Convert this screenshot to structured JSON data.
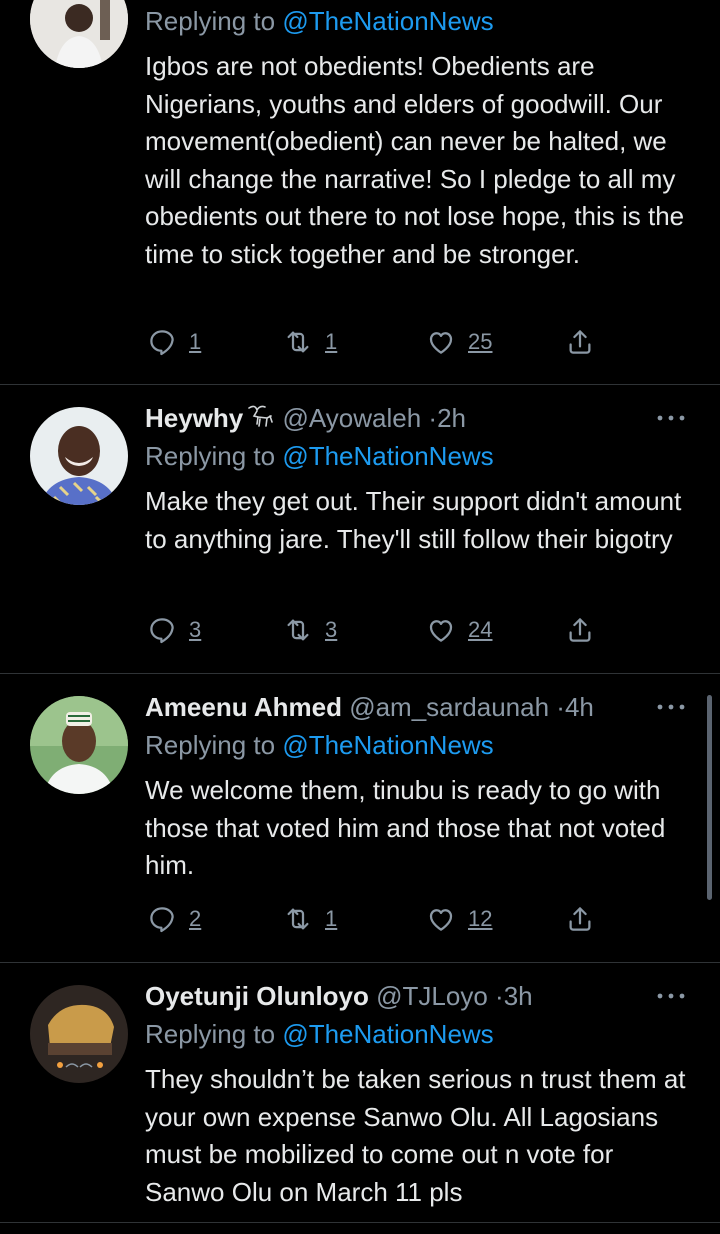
{
  "tweets": [
    {
      "name": "",
      "handle": "",
      "time": "",
      "reply_prefix": "Replying to ",
      "reply_to": "@TheNationNews",
      "text": "Igbos are not obedients! Obedients are Nigerians, youths and elders of goodwill. Our movement(obedient) can never be halted, we will change the narrative! So I pledge to all my obedients out there to not lose hope, this is the time to stick together and be stronger.",
      "replies": "1",
      "retweets": "1",
      "likes": "25"
    },
    {
      "name": "Heywhy",
      "handle": "@Ayowaleh",
      "time": "2h",
      "separator": "·",
      "reply_prefix": "Replying to ",
      "reply_to": "@TheNationNews",
      "text": "Make they get out. Their support didn't amount to anything jare. They'll still follow their bigotry",
      "replies": "3",
      "retweets": "3",
      "likes": "24"
    },
    {
      "name": "Ameenu Ahmed",
      "handle": "@am_sardaunah",
      "time": "4h",
      "separator": "·",
      "reply_prefix": "Replying to ",
      "reply_to": "@TheNationNews",
      "text": "We welcome them, tinubu is ready to go with those that voted him and those that not voted him.",
      "replies": "2",
      "retweets": "1",
      "likes": "12"
    },
    {
      "name": "Oyetunji Olunloyo",
      "handle": "@TJLoyo",
      "time": "3h",
      "separator": "·",
      "reply_prefix": "Replying to ",
      "reply_to": "@TheNationNews",
      "text": "They shouldn’t be taken serious n trust them at your own expense Sanwo Olu. All Lagosians must be mobilized to come out n vote for Sanwo Olu on March 11 pls"
    }
  ],
  "colors": {
    "background": "#000000",
    "text": "#e7e9ea",
    "secondary": "#8b98a5",
    "accent": "#1d9bf0",
    "divider": "#2f3336"
  },
  "icons": [
    "reply-icon",
    "retweet-icon",
    "like-icon",
    "share-icon",
    "more-icon",
    "goat-badge-icon"
  ]
}
